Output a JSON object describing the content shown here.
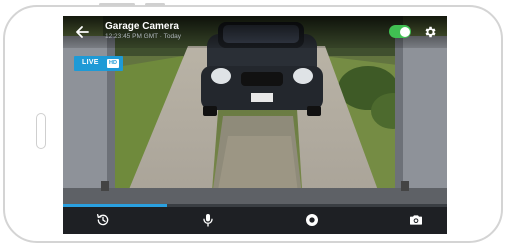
{
  "camera": {
    "title": "Garage Camera",
    "subtitle": "12:23:45 PM GMT · Today",
    "live_label": "LIVE",
    "hd_label": "HD",
    "enabled": true
  },
  "playback": {
    "progress_percent": 27
  },
  "icons": {
    "back": "arrow-left-icon",
    "settings": "gear-icon",
    "history": "history-icon",
    "microphone": "microphone-icon",
    "record": "record-icon",
    "snapshot": "camera-icon"
  },
  "colors": {
    "accent": "#1e9ad6",
    "toggle_on": "#40c052",
    "bar_background": "#1e2024"
  }
}
